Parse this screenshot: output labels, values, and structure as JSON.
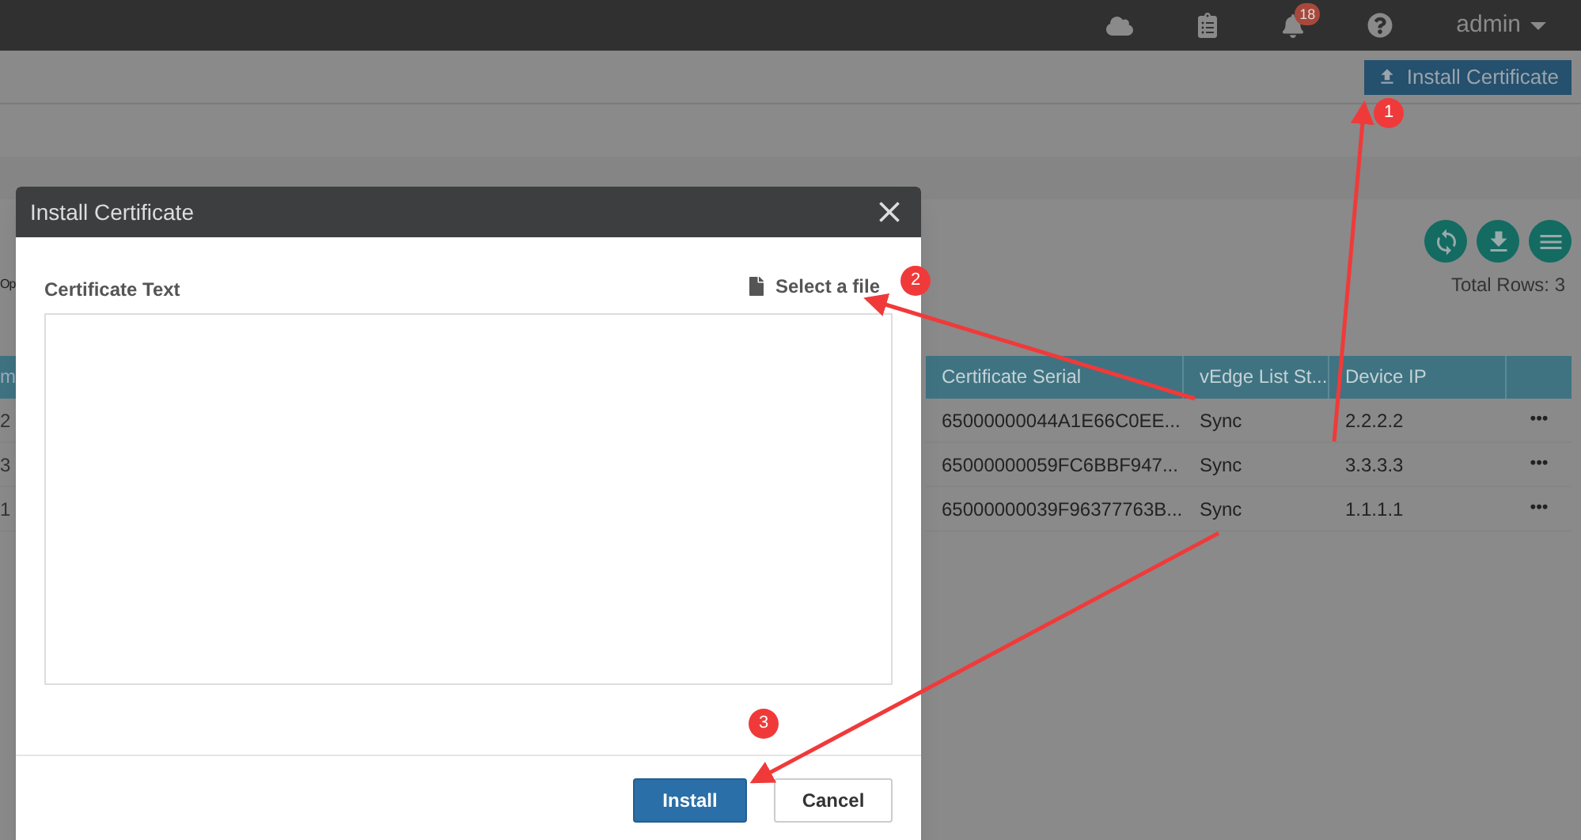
{
  "top_bar": {
    "notification_count": "18",
    "user": "admin"
  },
  "toolbar": {
    "install_button": "Install Certificate"
  },
  "filter_fragment": "Op",
  "total_rows": "Total Rows: 3",
  "table": {
    "columns": [
      "m",
      "Certificate Serial",
      "vEdge List St...",
      "Device IP"
    ],
    "rows": [
      {
        "column_1": "2",
        "serial": "65000000044A1E66C0EE...",
        "status": "Sync",
        "ip": "2.2.2.2",
        "actions": "•••"
      },
      {
        "column_1": "3",
        "serial": "65000000059FC6BBF947...",
        "status": "Sync",
        "ip": "3.3.3.3",
        "actions": "•••"
      },
      {
        "column_1": "1",
        "serial": "65000000039F96377763B...",
        "status": "Sync",
        "ip": "1.1.1.1",
        "actions": "•••"
      }
    ]
  },
  "dialog": {
    "title": "Install Certificate",
    "field_label": "Certificate Text",
    "select_file": "Select a file",
    "buttons": [
      {
        "label": "Install",
        "kind": "primary"
      },
      {
        "label": "Cancel",
        "kind": "secondary"
      }
    ]
  },
  "annotations": [
    "1",
    "2",
    "3"
  ]
}
